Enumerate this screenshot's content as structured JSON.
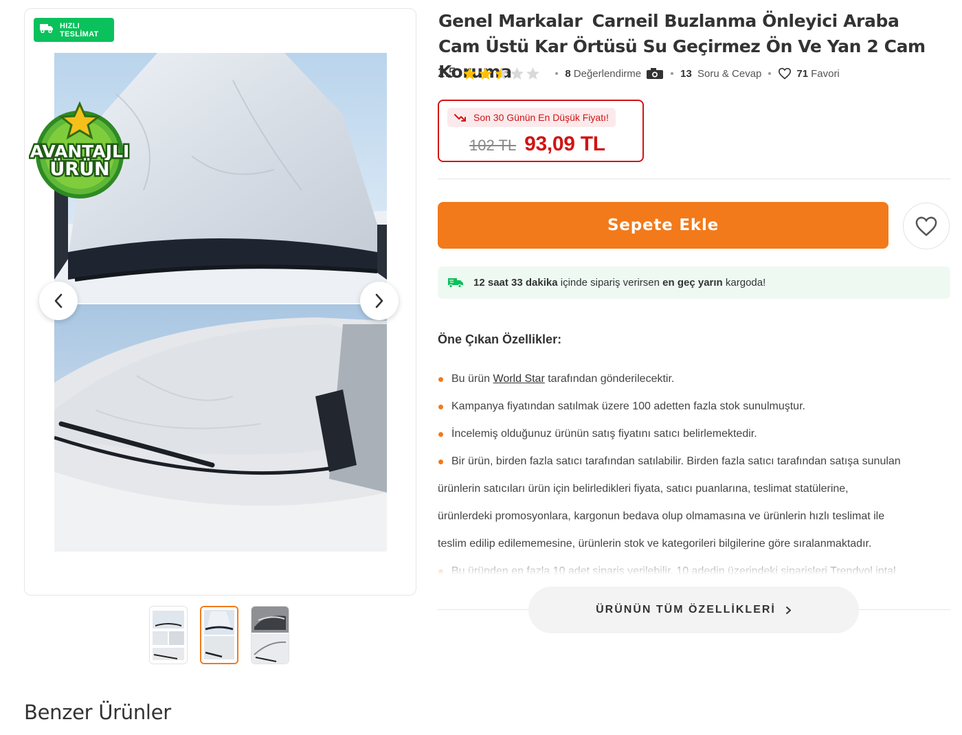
{
  "badges": {
    "fast_delivery_line1": "HIZLI",
    "fast_delivery_line2": "TESLİMAT",
    "advantage_line1": "AVANTAJLI",
    "advantage_line2": "ÜRÜN"
  },
  "gallery": {
    "selected_index": 1,
    "thumbnail_count": 3
  },
  "product": {
    "brand": "Genel Markalar",
    "name": "Carneil Buzlanma Önleyici Araba Cam Üstü Kar Örtüsü Su Geçirmez Ön Ve Yan 2 Cam Koruma"
  },
  "rating": {
    "score": "2.5",
    "stars_value": 2.5,
    "stars_max": 5,
    "reviews_count": "8",
    "reviews_label": "Değerlendirme",
    "qa_count": "13",
    "qa_label": "Soru & Cevap",
    "favorites_count": "71",
    "favorites_label": "Favori"
  },
  "price": {
    "tag": "Son 30 Günün En Düşük Fiyatı!",
    "old": "102 TL",
    "current": "93,09 TL"
  },
  "actions": {
    "add_to_cart": "Sepete Ekle"
  },
  "shipping": {
    "time": "12 saat 33 dakika",
    "text_mid": "içinde sipariş verirsen",
    "highlight": "en geç yarın",
    "text_end": "kargoda!"
  },
  "features": {
    "title": "Öne Çıkan Özellikler:",
    "f1_pre": "Bu ürün",
    "f1_link": "World Star",
    "f1_post": "tarafından gönderilecektir.",
    "f2": "Kampanya fiyatından satılmak üzere 100 adetten fazla stok sunulmuştur.",
    "f3": "İncelemiş olduğunuz ürünün satış fiyatını satıcı belirlemektedir.",
    "f4_l1": "Bir ürün, birden fazla satıcı tarafından satılabilir. Birden fazla satıcı tarafından satışa sunulan",
    "f4_l2": "ürünlerin satıcıları ürün için belirledikleri fiyata, satıcı puanlarına, teslimat statülerine,",
    "f4_l3": "ürünlerdeki promosyonlara, kargonun bedava olup olmamasına ve ürünlerin hızlı teslimat ile",
    "f4_l4": "teslim edilip edilememesine, ürünlerin stok ve kategorileri bilgilerine göre sıralanmaktadır.",
    "f5": "Bu üründen en fazla 10 adet sipariş verilebilir. 10 adedin üzerindeki siparişleri Trendyol iptal",
    "all_button": "ÜRÜNÜN TÜM ÖZELLİKLERİ"
  },
  "similar": {
    "title": "Benzer Ürünler"
  },
  "colors": {
    "accent": "#f27a1a",
    "price_red": "#d21313",
    "fast_green": "#0bc15c",
    "star": "#ffc000"
  },
  "icons": [
    "truck-icon",
    "camera-icon",
    "heart-icon",
    "chevron-left-icon",
    "chevron-right-icon",
    "trend-down-icon",
    "star-icon"
  ]
}
